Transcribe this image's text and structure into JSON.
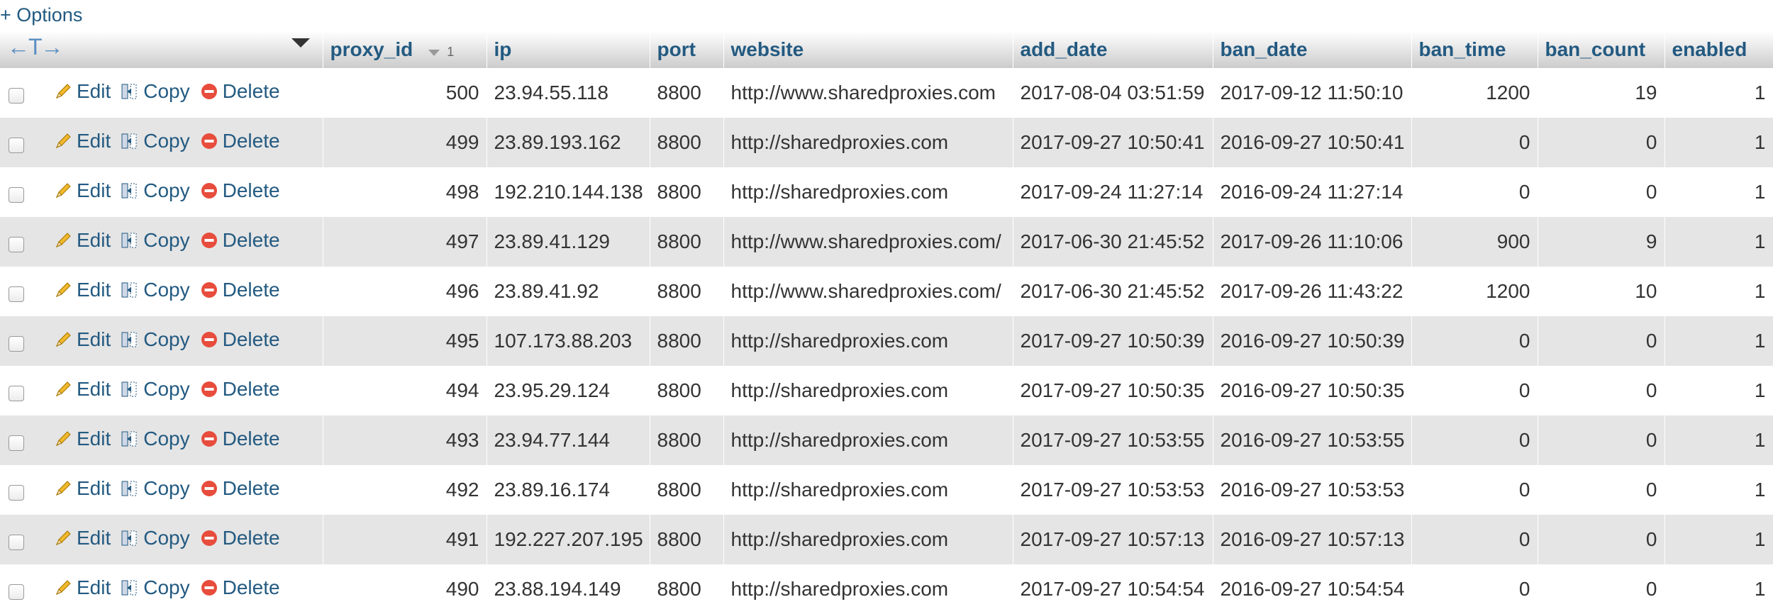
{
  "options_label": "+ Options",
  "controls": {
    "edit_label": "Edit",
    "copy_label": "Copy",
    "delete_label": "Delete"
  },
  "sort": {
    "column": "proxy_id",
    "direction": "descending",
    "order_label": "1"
  },
  "columns": [
    "proxy_id",
    "ip",
    "port",
    "website",
    "add_date",
    "ban_date",
    "ban_time",
    "ban_count",
    "enabled"
  ],
  "rows": [
    [
      "500",
      "23.94.55.118",
      "8800",
      "http://www.sharedproxies.com",
      "2017-08-04 03:51:59",
      "2017-09-12 11:50:10",
      "1200",
      "19",
      "1"
    ],
    [
      "499",
      "23.89.193.162",
      "8800",
      "http://sharedproxies.com",
      "2017-09-27 10:50:41",
      "2016-09-27 10:50:41",
      "0",
      "0",
      "1"
    ],
    [
      "498",
      "192.210.144.138",
      "8800",
      "http://sharedproxies.com",
      "2017-09-24 11:27:14",
      "2016-09-24 11:27:14",
      "0",
      "0",
      "1"
    ],
    [
      "497",
      "23.89.41.129",
      "8800",
      "http://www.sharedproxies.com/",
      "2017-06-30 21:45:52",
      "2017-09-26 11:10:06",
      "900",
      "9",
      "1"
    ],
    [
      "496",
      "23.89.41.92",
      "8800",
      "http://www.sharedproxies.com/",
      "2017-06-30 21:45:52",
      "2017-09-26 11:43:22",
      "1200",
      "10",
      "1"
    ],
    [
      "495",
      "107.173.88.203",
      "8800",
      "http://sharedproxies.com",
      "2017-09-27 10:50:39",
      "2016-09-27 10:50:39",
      "0",
      "0",
      "1"
    ],
    [
      "494",
      "23.95.29.124",
      "8800",
      "http://sharedproxies.com",
      "2017-09-27 10:50:35",
      "2016-09-27 10:50:35",
      "0",
      "0",
      "1"
    ],
    [
      "493",
      "23.94.77.144",
      "8800",
      "http://sharedproxies.com",
      "2017-09-27 10:53:55",
      "2016-09-27 10:53:55",
      "0",
      "0",
      "1"
    ],
    [
      "492",
      "23.89.16.174",
      "8800",
      "http://sharedproxies.com",
      "2017-09-27 10:53:53",
      "2016-09-27 10:53:53",
      "0",
      "0",
      "1"
    ],
    [
      "491",
      "192.227.207.195",
      "8800",
      "http://sharedproxies.com",
      "2017-09-27 10:57:13",
      "2016-09-27 10:57:13",
      "0",
      "0",
      "1"
    ],
    [
      "490",
      "23.88.194.149",
      "8800",
      "http://sharedproxies.com",
      "2017-09-27 10:54:54",
      "2016-09-27 10:54:54",
      "0",
      "0",
      "1"
    ]
  ],
  "colors": {
    "link": "#235a81",
    "row_alt": "#e5e5e5",
    "delete_icon": "#e74c3c",
    "edit_icon": "#f1b82d"
  }
}
